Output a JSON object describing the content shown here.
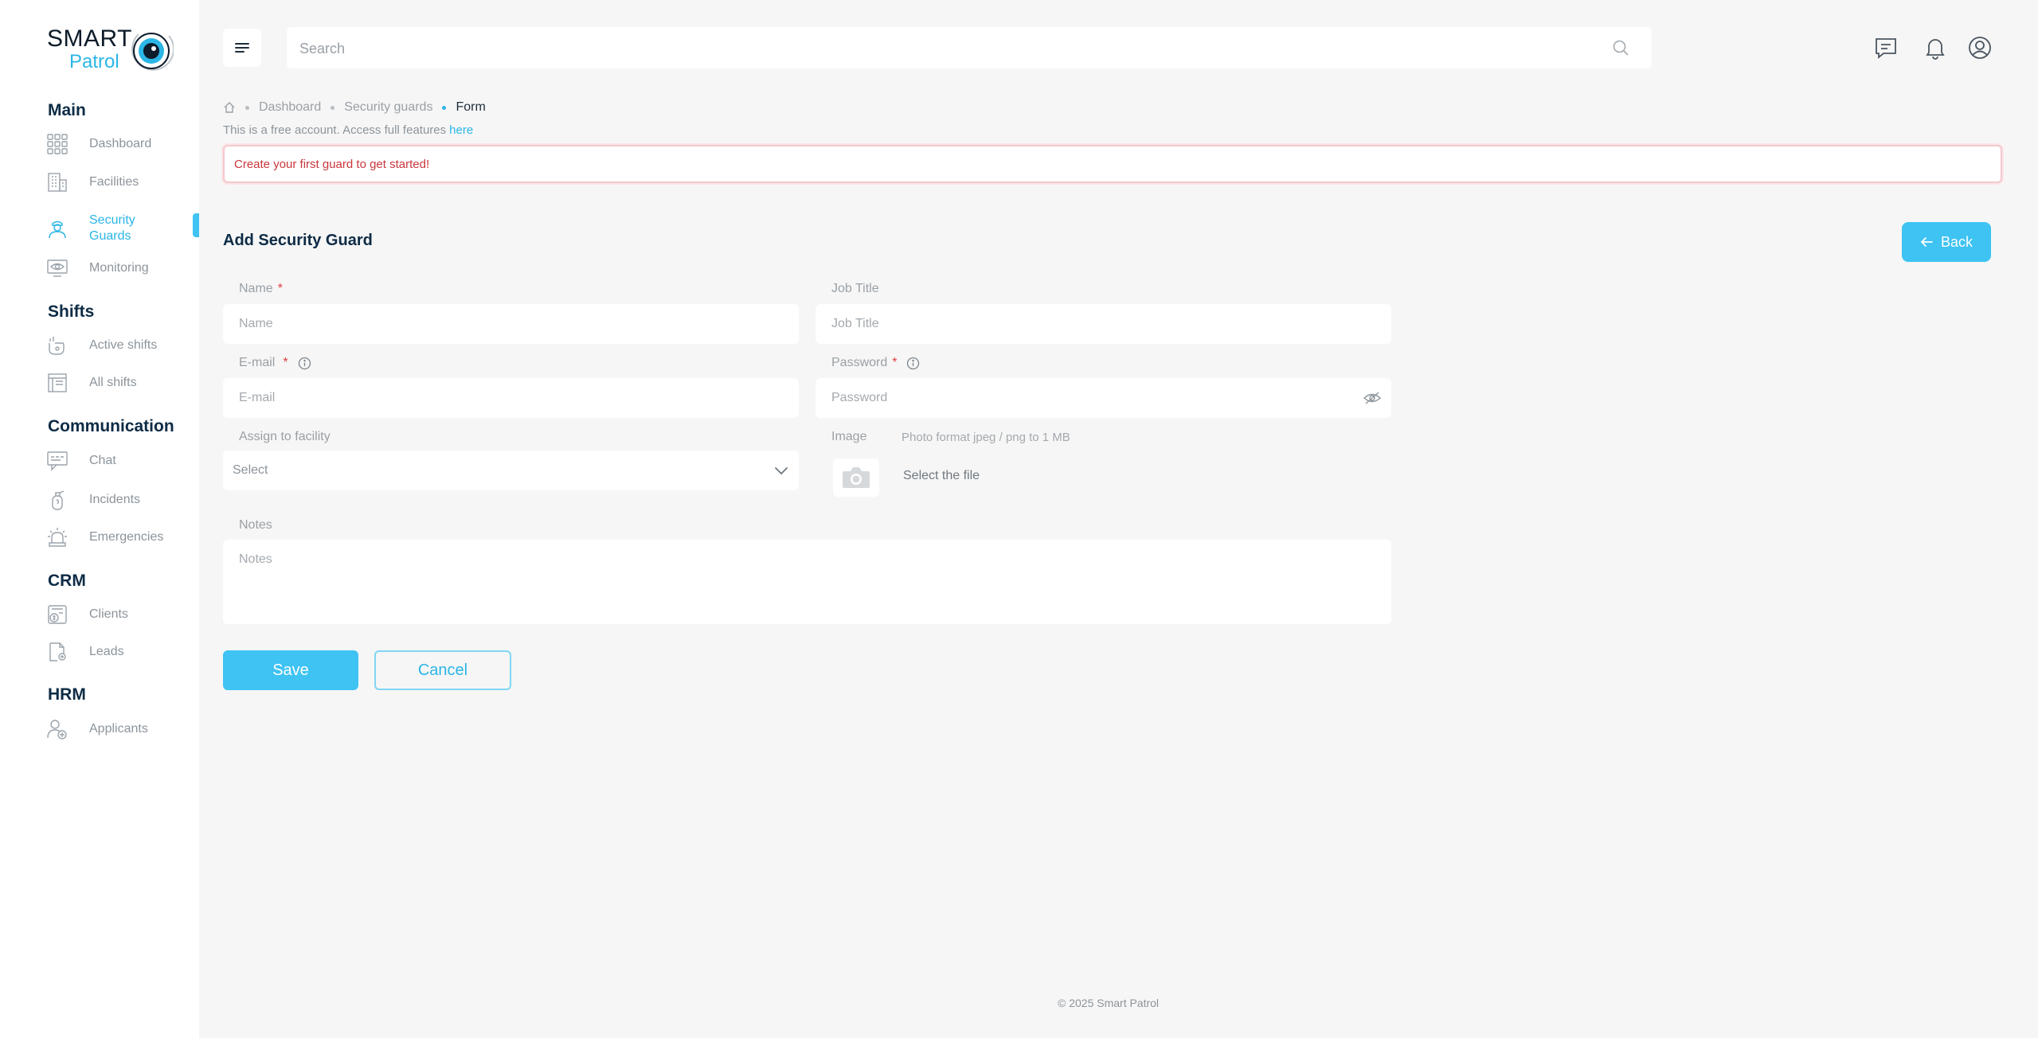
{
  "brand": {
    "name_top": "SMART",
    "name_bottom": "Patrol",
    "accent": "#2bb6e6",
    "button_color": "#3ec3f2"
  },
  "sidebar": {
    "sections": [
      {
        "title": "Main",
        "items": [
          {
            "label": "Dashboard",
            "icon": "grid-icon"
          },
          {
            "label": "Facilities",
            "icon": "building-icon"
          },
          {
            "label": "Security Guards",
            "icon": "guard-icon",
            "active": true
          },
          {
            "label": "Monitoring",
            "icon": "monitor-eye-icon"
          }
        ]
      },
      {
        "title": "Shifts",
        "items": [
          {
            "label": "Active shifts",
            "icon": "hand-icon"
          },
          {
            "label": "All shifts",
            "icon": "board-icon"
          }
        ]
      },
      {
        "title": "Communication",
        "items": [
          {
            "label": "Chat",
            "icon": "chat-icon"
          },
          {
            "label": "Incidents",
            "icon": "fire-extinguisher-icon"
          },
          {
            "label": "Emergencies",
            "icon": "alarm-icon"
          }
        ]
      },
      {
        "title": "CRM",
        "items": [
          {
            "label": "Clients",
            "icon": "clients-icon"
          },
          {
            "label": "Leads",
            "icon": "leads-icon"
          }
        ]
      },
      {
        "title": "HRM",
        "items": [
          {
            "label": "Applicants",
            "icon": "applicant-icon"
          }
        ]
      }
    ]
  },
  "topbar": {
    "search_placeholder": "Search",
    "icons": [
      "menu-icon",
      "search-icon",
      "message-icon",
      "bell-icon",
      "user-circle-icon"
    ]
  },
  "breadcrumb": {
    "items": [
      "Dashboard",
      "Security guards"
    ],
    "current": "Form",
    "home_icon": "home-icon"
  },
  "free_note": {
    "text": "This is a free account. Access full features",
    "link": "here"
  },
  "alert": {
    "text": "Create your first guard to get started!"
  },
  "form": {
    "title": "Add Security Guard",
    "back_label": "Back",
    "name": {
      "label": "Name",
      "placeholder": "Name",
      "required": "*"
    },
    "job_title": {
      "label": "Job Title",
      "placeholder": "Job Title"
    },
    "email": {
      "label": "E-mail",
      "placeholder": "E-mail",
      "required": "*"
    },
    "password": {
      "label": "Password",
      "placeholder": "Password",
      "required": "*"
    },
    "facility": {
      "label": "Assign to facility",
      "value": "Select"
    },
    "image": {
      "label": "Image",
      "hint": "Photo format jpeg / png to 1 MB",
      "select_label": "Select the file"
    },
    "notes": {
      "label": "Notes",
      "placeholder": "Notes"
    },
    "save_label": "Save",
    "cancel_label": "Cancel"
  },
  "footer": {
    "text": "© 2025 Smart Patrol"
  }
}
